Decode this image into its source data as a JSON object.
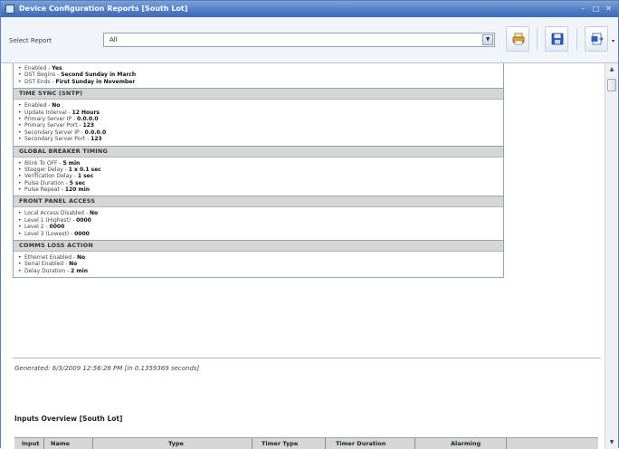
{
  "window": {
    "title": "Device Configuration Reports [South Lot]",
    "controls": {
      "minimize": "–",
      "maximize": "□",
      "close": "✕"
    }
  },
  "toolbar": {
    "select_label": "Select Report",
    "select_value": "All",
    "icons": [
      "print-icon",
      "save-icon",
      "export-icon"
    ]
  },
  "sections": [
    {
      "title": "",
      "items": [
        {
          "label": "Enabled - ",
          "value": "Yes"
        },
        {
          "label": "DST Begins - ",
          "value": "Second Sunday in March"
        },
        {
          "label": "DST Ends - ",
          "value": "First Sunday in November"
        }
      ]
    },
    {
      "title": "TIME SYNC (SNTP)",
      "items": [
        {
          "label": "Enabled - ",
          "value": "No"
        },
        {
          "label": "Update Interval - ",
          "value": "12 Hours"
        },
        {
          "label": "Primary Server IP - ",
          "value": "0.0.0.0"
        },
        {
          "label": "Primary Server Port - ",
          "value": "123"
        },
        {
          "label": "Secondary Server IP - ",
          "value": "0.0.0.0"
        },
        {
          "label": "Secondary Server Port - ",
          "value": "123"
        }
      ]
    },
    {
      "title": "GLOBAL BREAKER TIMING",
      "items": [
        {
          "label": "Blink To OFF - ",
          "value": "5 min"
        },
        {
          "label": "Stagger Delay - ",
          "value": "1 x 0.1 sec"
        },
        {
          "label": "Verification Delay - ",
          "value": "1 sec"
        },
        {
          "label": "Pulse Duration - ",
          "value": "5 sec"
        },
        {
          "label": "Pulse Repeat - ",
          "value": "120 min"
        }
      ]
    },
    {
      "title": "FRONT PANEL ACCESS",
      "items": [
        {
          "label": "Local Access Disabled - ",
          "value": "No"
        },
        {
          "label": "Level 1 (Highest) - ",
          "value": "0000"
        },
        {
          "label": "Level 2 - ",
          "value": "0000"
        },
        {
          "label": "Level 3 (Lowest) - ",
          "value": "0000"
        }
      ]
    },
    {
      "title": "COMMS LOSS ACTION",
      "items": [
        {
          "label": "Ethernet Enabled - ",
          "value": "No"
        },
        {
          "label": "Serial Enabled - ",
          "value": "No"
        },
        {
          "label": "Delay Duration - ",
          "value": "2 min"
        }
      ]
    }
  ],
  "generated": "Generated: 6/3/2009 12:56:26 PM [in 0.1359369 seconds]",
  "inputs_overview": {
    "title": "Inputs Overview [South Lot]",
    "columns": [
      "Input",
      "Name",
      "Type",
      "Timer Type",
      "Timer Duration",
      "Alarming"
    ]
  }
}
